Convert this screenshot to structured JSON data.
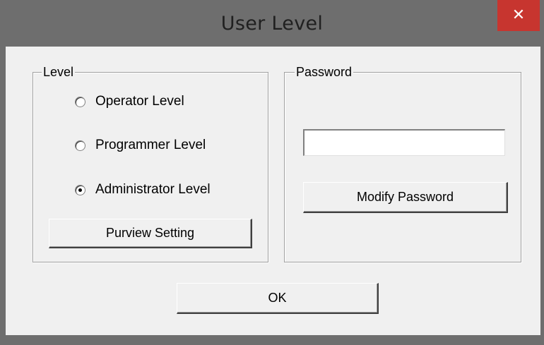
{
  "window": {
    "title": "User Level",
    "close_glyph": "✕"
  },
  "level_group": {
    "label": "Level",
    "options": [
      {
        "label": "Operator Level",
        "checked": false
      },
      {
        "label": "Programmer Level",
        "checked": false
      },
      {
        "label": "Administrator Level",
        "checked": true
      }
    ],
    "purview_button": "Purview Setting"
  },
  "password_group": {
    "label": "Password",
    "field_value": "",
    "modify_button": "Modify Password"
  },
  "ok_button": "OK",
  "colors": {
    "title_bar": "#6e6e6e",
    "close_button": "#c7352f",
    "dialog_face": "#f0f0f0"
  }
}
